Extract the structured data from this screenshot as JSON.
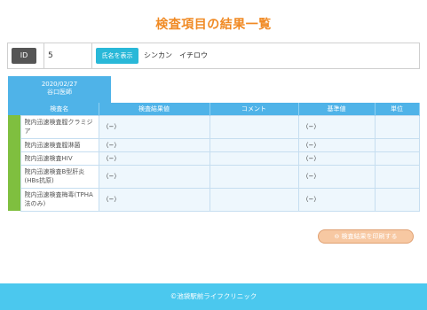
{
  "page": {
    "title": "検査項目の結果一覧"
  },
  "patient": {
    "id_label": "ID",
    "id_value": "5",
    "name_button_label": "氏名を表示",
    "name_value": "シンカン　イチロウ"
  },
  "tab": {
    "date": "2020/02/27",
    "clinic": "谷口医師"
  },
  "table": {
    "columns": [
      "検査名",
      "検査結果値",
      "コメント",
      "基準値",
      "単位"
    ],
    "rows": [
      {
        "name": "院内迅速検査膣クラミジア",
        "result": "（−）",
        "comment": "",
        "standard": "（−）",
        "unit": ""
      },
      {
        "name": "院内迅速検査膣淋菌",
        "result": "（−）",
        "comment": "",
        "standard": "（−）",
        "unit": ""
      },
      {
        "name": "院内迅速検査HIV",
        "result": "（−）",
        "comment": "",
        "standard": "（−）",
        "unit": ""
      },
      {
        "name": "院内迅速検査B型肝炎(HBs抗原)",
        "result": "（−）",
        "comment": "",
        "standard": "（−）",
        "unit": ""
      },
      {
        "name": "院内迅速検査梅毒(TPHA法のみ)",
        "result": "（−）",
        "comment": "",
        "standard": "（−）",
        "unit": ""
      }
    ]
  },
  "actions": {
    "print_label": "⊖ 検査結果を印刷する"
  },
  "footer": {
    "copyright": "©池袋駅前ライフクリニック"
  },
  "colors": {
    "accent": "#f08a24",
    "header_blue": "#4fb3e8",
    "footer_blue": "#4bc8ee",
    "gutter_green": "#7fbf3f"
  }
}
